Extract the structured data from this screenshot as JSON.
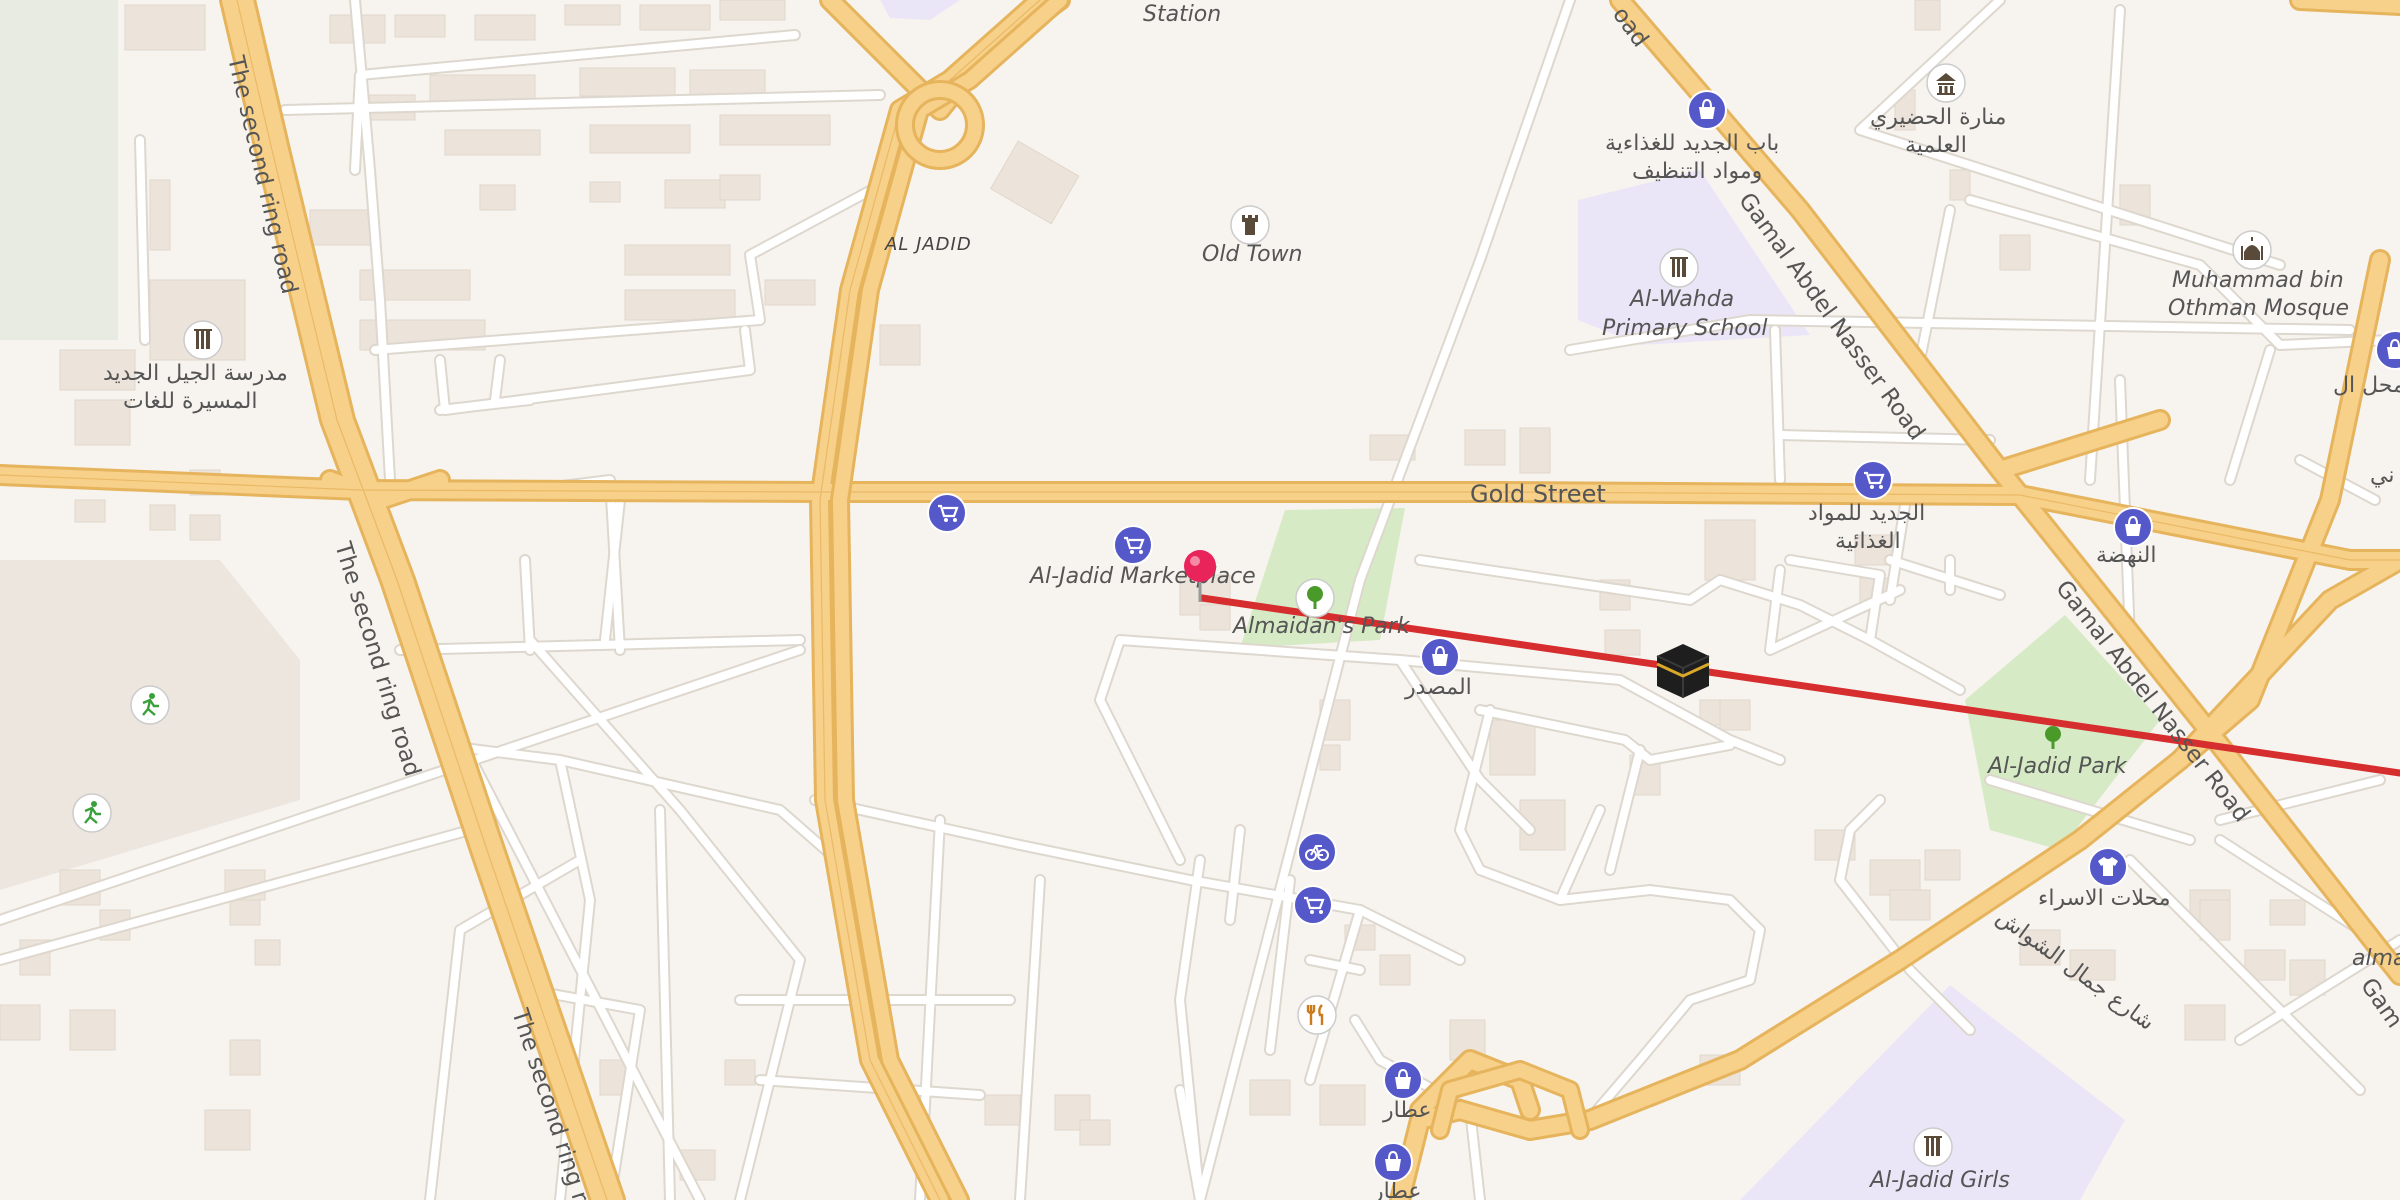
{
  "map": {
    "roads": {
      "second_ring_1": "The second ring road",
      "second_ring_2": "The second ring road",
      "second_ring_3": "The second ring ro",
      "gold_street": "Gold Street",
      "gamal_1": "Gamal Abdel Nasser Road",
      "gamal_2": "Gamal Abdel Nasser Road",
      "gamal_top": "oad",
      "gamal_edge": "Gam",
      "shawqi": "شارع جمال الشواش"
    },
    "places": {
      "station": "Station",
      "al_jadid": "AL JADID",
      "old_town": "Old Town",
      "marketplace": "Al-Jadid Marketplace",
      "almaidan_park": "Almaidan's Park",
      "wahda_1": "Al-Wahda",
      "wahda_2": "Primary School",
      "muhammad_1": "Muhammad bin",
      "muhammad_2": "Othman Mosque",
      "jadid_park": "Al-Jadid Park",
      "girls_1": "Al-Jadid Girls",
      "alma_edge": "alma",
      "ar_school_1": "مدرسة الجيل الجديد",
      "ar_school_2": "المسيرة للغات",
      "ar_bab_1": "باب الجديد للغذاءية",
      "ar_bab_2": "ومواد التنظيف",
      "ar_manara_1": "منارة الحضيري",
      "ar_manara_2": "العلمية",
      "ar_jadid_food_1": "الجديد للمواد",
      "ar_jadid_food_2": "الغذائية",
      "ar_nahda": "النهضة",
      "ar_masdar": "المصدر",
      "ar_israa": "محلات الاسراء",
      "ar_attar_1": "عطار",
      "ar_attar_2": "عطار",
      "ar_mahal": "محل ال",
      "ar_edge": "ني"
    },
    "colors": {
      "background": "#f7f4ef",
      "major_road": "#f7cf7a",
      "major_road_casing": "#e6b45c",
      "minor_road": "#ffffff",
      "minor_road_casing": "#d9d4cc",
      "building": "#ece4db",
      "park": "#d6eac6",
      "school_area": "#ebe6f7",
      "qibla_line": "#d62e2e",
      "pin": "#e8245a",
      "poi_blue": "#5558c8",
      "park_icon": "#4a9a2a",
      "food_icon": "#cc7a1c",
      "sport_icon": "#3aa13a"
    },
    "icons": {
      "marker": "map-pin-icon",
      "kaaba": "kaaba-icon",
      "shop": "shopping-cart-icon",
      "bag": "shopping-bag-icon",
      "school": "school-icon",
      "museum": "museum-icon",
      "mosque": "mosque-icon",
      "tower": "tower-icon",
      "tree": "tree-icon",
      "bicycle": "bicycle-icon",
      "restaurant": "restaurant-icon",
      "shirt": "clothes-shop-icon",
      "sport": "sport-icon"
    }
  }
}
